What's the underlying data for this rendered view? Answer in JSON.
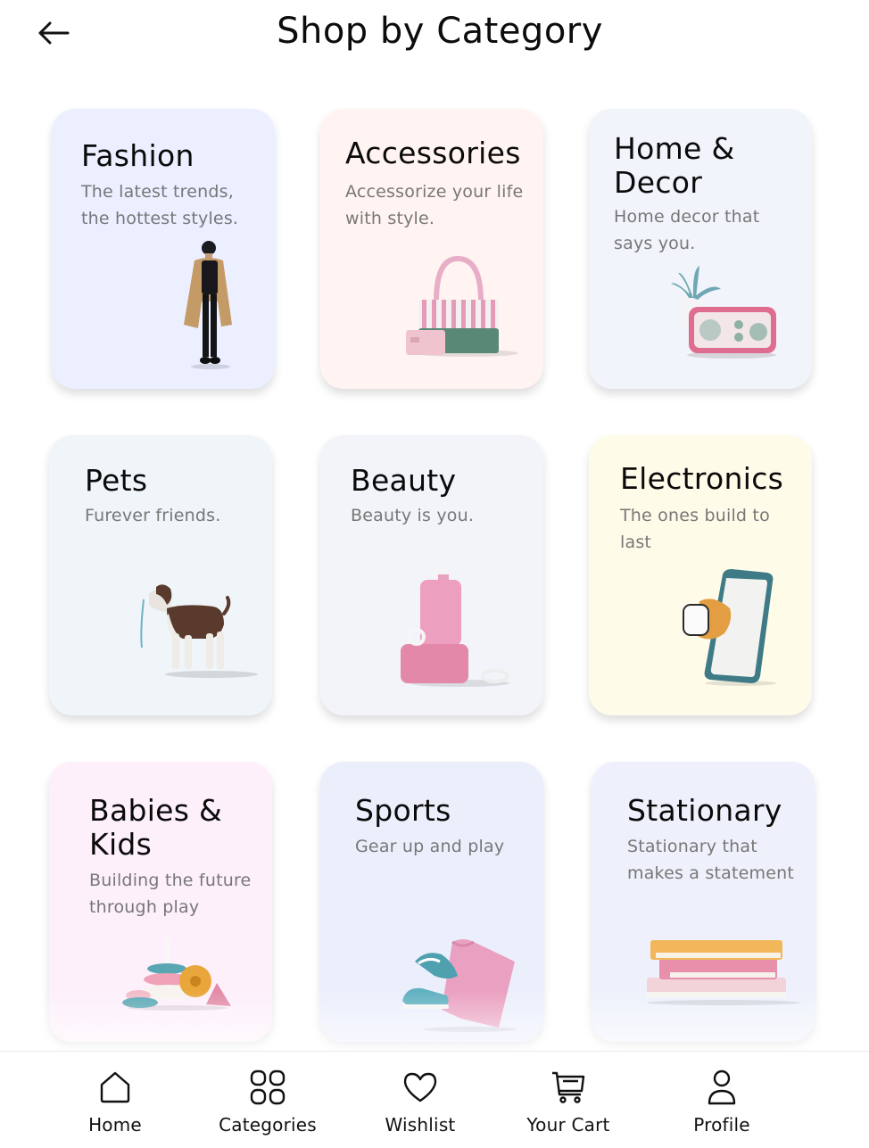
{
  "header": {
    "title": "Shop by Category",
    "back_icon": "arrow-left-icon"
  },
  "categories": [
    {
      "title": "Fashion",
      "description": "The latest trends, the hottest styles.",
      "background": "#ebefff",
      "icon": "fashion-model-illustration"
    },
    {
      "title": "Accessories",
      "description": "Accessorize your life with style.",
      "background": "#fff4f1",
      "icon": "handbag-illustration"
    },
    {
      "title": "Home & Decor",
      "description": "Home decor that says you.",
      "background": "#f2f4fb",
      "icon": "radio-plant-illustration"
    },
    {
      "title": "Pets",
      "description": "Furever friends.",
      "background": "#eff5f9",
      "icon": "dog-illustration"
    },
    {
      "title": "Beauty",
      "description": "Beauty is you.",
      "background": "#f2f4fa",
      "icon": "cosmetics-illustration"
    },
    {
      "title": "Electronics",
      "description": "The ones build to last",
      "background": "#fffbe9",
      "icon": "phone-watch-illustration"
    },
    {
      "title": "Babies & Kids",
      "description": "Building the future through play",
      "background": "#fdf0fb",
      "icon": "stacking-toys-illustration"
    },
    {
      "title": "Sports",
      "description": "Gear up and play",
      "background": "#ebeffc",
      "icon": "sneakers-shirt-illustration"
    },
    {
      "title": "Stationary",
      "description": "Stationary that makes a statement",
      "background": "#eef1fb",
      "icon": "books-illustration"
    }
  ],
  "bottom_nav": [
    {
      "label": "Home",
      "icon": "home-icon"
    },
    {
      "label": "Categories",
      "icon": "grid-icon"
    },
    {
      "label": "Wishlist",
      "icon": "heart-icon"
    },
    {
      "label": "Your Cart",
      "icon": "cart-icon"
    },
    {
      "label": "Profile",
      "icon": "user-icon"
    }
  ]
}
